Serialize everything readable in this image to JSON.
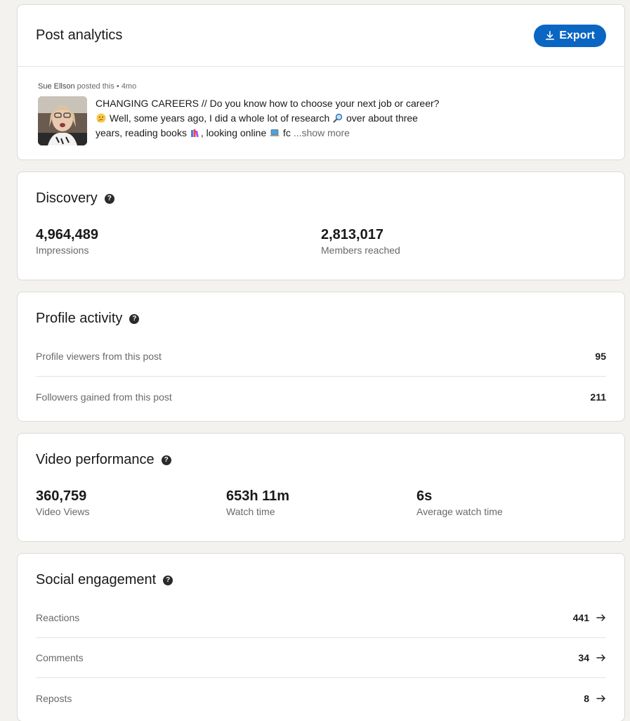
{
  "header": {
    "title": "Post analytics",
    "export_label": "Export",
    "export_icon": "download-icon",
    "accent_color": "#0a66c2"
  },
  "post": {
    "author": "Sue Ellson",
    "meta_suffix": " posted this • 4mo",
    "text_1": "CHANGING CAREERS // Do you know how to choose your next job or career? ",
    "text_2": " Well, some years ago, I did a whole lot of research ",
    "text_3": " over about three years, reading books ",
    "text_4": ", looking online ",
    "text_5": " fc ",
    "show_more": "...show more"
  },
  "discovery": {
    "title": "Discovery",
    "metrics": [
      {
        "value": "4,964,489",
        "label": "Impressions"
      },
      {
        "value": "2,813,017",
        "label": "Members reached"
      }
    ]
  },
  "profile_activity": {
    "title": "Profile activity",
    "rows": [
      {
        "label": "Profile viewers from this post",
        "value": "95"
      },
      {
        "label": "Followers gained from this post",
        "value": "211"
      }
    ]
  },
  "video_performance": {
    "title": "Video performance",
    "metrics": [
      {
        "value": "360,759",
        "label": "Video Views"
      },
      {
        "value": "653h 11m",
        "label": "Watch time"
      },
      {
        "value": "6s",
        "label": "Average watch time"
      }
    ]
  },
  "social_engagement": {
    "title": "Social engagement",
    "rows": [
      {
        "label": "Reactions",
        "value": "441"
      },
      {
        "label": "Comments",
        "value": "34"
      },
      {
        "label": "Reposts",
        "value": "8"
      }
    ]
  }
}
